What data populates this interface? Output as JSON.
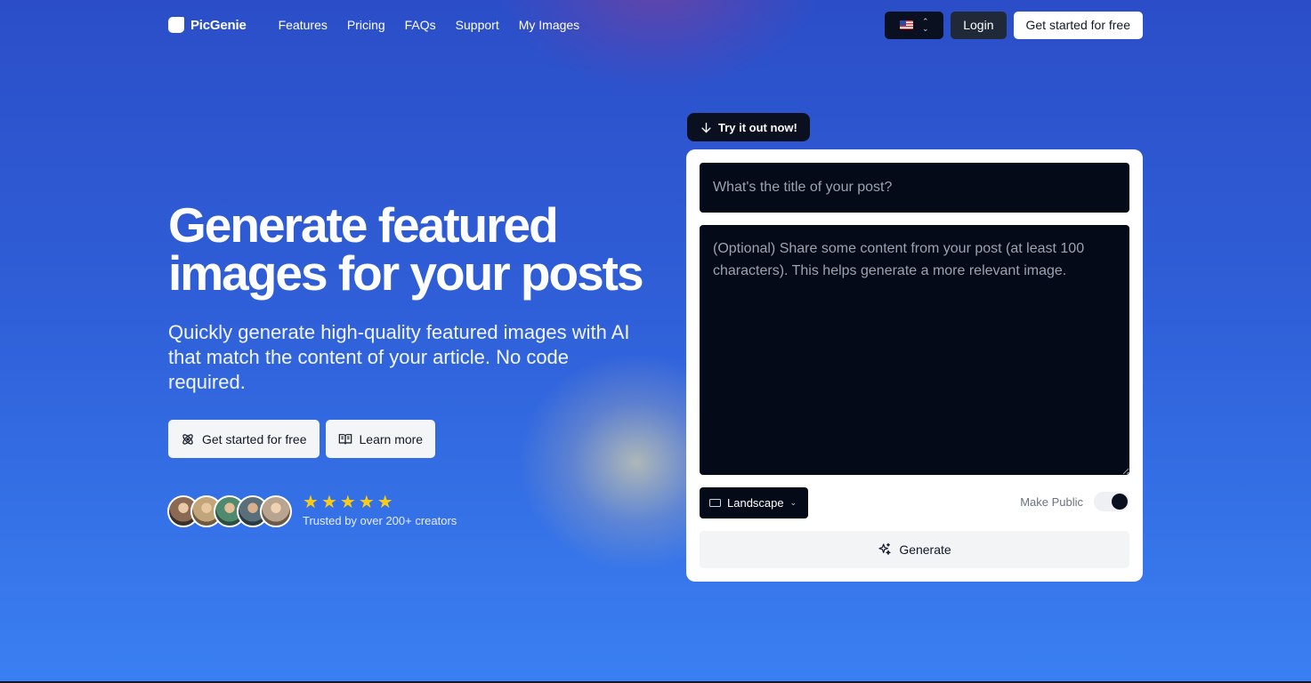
{
  "nav": {
    "brand": "PicGenie",
    "links": [
      "Features",
      "Pricing",
      "FAQs",
      "Support",
      "My Images"
    ],
    "language_flag": "us-flag-icon",
    "login_label": "Login",
    "cta_label": "Get started for free"
  },
  "hero": {
    "title": "Generate featured images for your posts",
    "subtitle": "Quickly generate high-quality featured images with AI that match the content of your article. No code required.",
    "primary_button": "Get started for free",
    "secondary_button": "Learn more",
    "stars": 5,
    "trusted_text": "Trusted by over 200+ creators",
    "avatar_colors": [
      "#8b6a55",
      "#c2a57a",
      "#4f8a6f",
      "#5a6f7a",
      "#b9a58f"
    ]
  },
  "form": {
    "try_label": "Try it out now!",
    "title_placeholder": "What's the title of your post?",
    "content_placeholder": "(Optional) Share some content from your post (at least 100 characters). This helps generate a more relevant image.",
    "orientation_label": "Landscape",
    "make_public_label": "Make Public",
    "make_public_on": true,
    "generate_label": "Generate"
  },
  "colors": {
    "accent_dark": "#0b1020",
    "star": "#facc15"
  }
}
